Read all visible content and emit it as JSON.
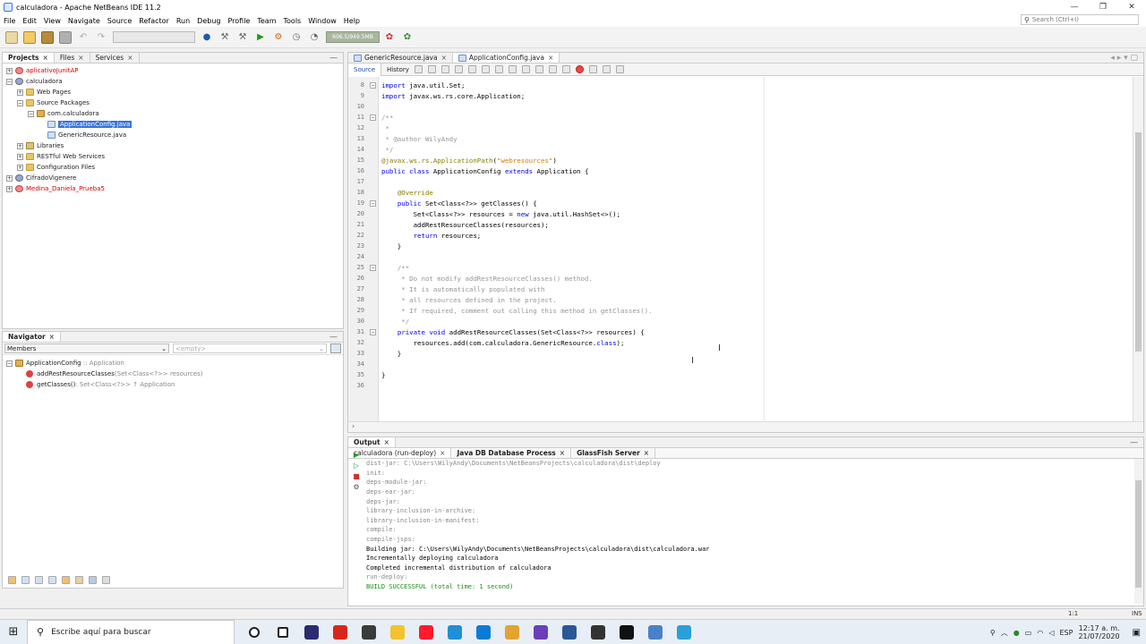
{
  "window": {
    "title": "calculadora - Apache NetBeans IDE 11.2",
    "controls": [
      "—",
      "❐",
      "✕"
    ]
  },
  "menu": [
    "File",
    "Edit",
    "View",
    "Navigate",
    "Source",
    "Refactor",
    "Run",
    "Debug",
    "Profile",
    "Team",
    "Tools",
    "Window",
    "Help"
  ],
  "search": {
    "placeholder": "Search (Ctrl+I)"
  },
  "toolbar": {
    "memory": "606.5/949.5MB"
  },
  "projects_panel": {
    "tabs": [
      "Projects",
      "Files",
      "Services"
    ],
    "tree": [
      {
        "label": "aplicativoJunitAP",
        "level": 0,
        "exp": "+",
        "icon": "proj-err",
        "cls": "red"
      },
      {
        "label": "calculadora",
        "level": 0,
        "exp": "−",
        "icon": "proj",
        "cls": ""
      },
      {
        "label": "Web Pages",
        "level": 1,
        "exp": "+",
        "icon": "folder",
        "cls": ""
      },
      {
        "label": "Source Packages",
        "level": 1,
        "exp": "−",
        "icon": "folder",
        "cls": ""
      },
      {
        "label": "com.calculadora",
        "level": 2,
        "exp": "−",
        "icon": "pkg",
        "cls": ""
      },
      {
        "label": "ApplicationConfig.java",
        "level": 3,
        "exp": "",
        "icon": "java",
        "cls": "sel"
      },
      {
        "label": "GenericResource.java",
        "level": 3,
        "exp": "",
        "icon": "java",
        "cls": ""
      },
      {
        "label": "Libraries",
        "level": 1,
        "exp": "+",
        "icon": "lib",
        "cls": ""
      },
      {
        "label": "RESTful Web Services",
        "level": 1,
        "exp": "+",
        "icon": "folder",
        "cls": ""
      },
      {
        "label": "Configuration Files",
        "level": 1,
        "exp": "+",
        "icon": "folder",
        "cls": ""
      },
      {
        "label": "CifradoVigenere",
        "level": 0,
        "exp": "+",
        "icon": "proj",
        "cls": ""
      },
      {
        "label": "Medina_Daniela_Prueba5",
        "level": 0,
        "exp": "+",
        "icon": "proj-err",
        "cls": "red"
      }
    ]
  },
  "navigator": {
    "title": "Navigator",
    "filter": "Members",
    "empty": "<empty>",
    "root_name": "ApplicationConfig",
    "root_type": ":: Application",
    "members": [
      {
        "name": "addRestResourceClasses",
        "sig": "(Set<Class<?>> resources)"
      },
      {
        "name": "getClasses()",
        "sig": ": Set<Class<?>> ↑ Application"
      }
    ]
  },
  "editor": {
    "tabs": [
      "GenericResource.java",
      "ApplicationConfig.java"
    ],
    "active_tab": 1,
    "modes": [
      "Source",
      "History"
    ],
    "lines": [
      {
        "n": "8",
        "fold": "−",
        "html": "<span class=\"kw\">import</span> java.util.Set;"
      },
      {
        "n": "9",
        "fold": "",
        "html": "<span class=\"kw\">import</span> javax.ws.rs.core.Application;"
      },
      {
        "n": "10",
        "fold": "",
        "html": ""
      },
      {
        "n": "11",
        "fold": "−",
        "html": "<span class=\"cm\">/**</span>"
      },
      {
        "n": "12",
        "fold": "",
        "html": "<span class=\"cm\"> *</span>"
      },
      {
        "n": "13",
        "fold": "",
        "html": "<span class=\"cm\"> * @author WilyAndy</span>"
      },
      {
        "n": "14",
        "fold": "",
        "html": "<span class=\"cm\"> */</span>"
      },
      {
        "n": "15",
        "fold": "",
        "html": "<span class=\"ann\">@javax.ws.rs.ApplicationPath</span>(<span class=\"str\">\"webresources\"</span>)"
      },
      {
        "n": "16",
        "fold": "",
        "html": "<span class=\"kw\">public class</span> ApplicationConfig <span class=\"kw\">extends</span> Application {"
      },
      {
        "n": "17",
        "fold": "",
        "html": ""
      },
      {
        "n": "18",
        "fold": "",
        "html": "    <span class=\"ann\">@Override</span>"
      },
      {
        "n": "19",
        "fold": "−",
        "html": "    <span class=\"kw\">public</span> Set&lt;Class&lt;?&gt;&gt; getClasses() {"
      },
      {
        "n": "20",
        "fold": "",
        "html": "        Set&lt;Class&lt;?&gt;&gt; resources = <span class=\"kw\">new</span> java.util.HashSet&lt;&gt;();"
      },
      {
        "n": "21",
        "fold": "",
        "html": "        addRestResourceClasses(resources);"
      },
      {
        "n": "22",
        "fold": "",
        "html": "        <span class=\"kw\">return</span> resources;"
      },
      {
        "n": "23",
        "fold": "",
        "html": "    }"
      },
      {
        "n": "24",
        "fold": "",
        "html": ""
      },
      {
        "n": "25",
        "fold": "−",
        "html": "    <span class=\"cm\">/**</span>"
      },
      {
        "n": "26",
        "fold": "",
        "html": "<span class=\"cm\">     * Do not modify addRestResourceClasses() method.</span>"
      },
      {
        "n": "27",
        "fold": "",
        "html": "<span class=\"cm\">     * It is automatically populated with</span>"
      },
      {
        "n": "28",
        "fold": "",
        "html": "<span class=\"cm\">     * all resources defined in the project.</span>"
      },
      {
        "n": "29",
        "fold": "",
        "html": "<span class=\"cm\">     * If required, comment out calling this method in getClasses().</span>"
      },
      {
        "n": "30",
        "fold": "",
        "html": "<span class=\"cm\">     */</span>"
      },
      {
        "n": "31",
        "fold": "−",
        "html": "    <span class=\"kw\">private void</span> addRestResourceClasses(Set&lt;Class&lt;?&gt;&gt; resources) {"
      },
      {
        "n": "32",
        "fold": "",
        "html": "        resources.add(com.calculadora.GenericResource.<span class=\"kw\">class</span>);"
      },
      {
        "n": "33",
        "fold": "",
        "html": "    }"
      },
      {
        "n": "34",
        "fold": "",
        "html": ""
      },
      {
        "n": "35",
        "fold": "",
        "html": "}"
      },
      {
        "n": "36",
        "fold": "",
        "html": ""
      }
    ]
  },
  "output": {
    "title": "Output",
    "tabs": [
      "calculadora (run-deploy)",
      "Java DB Database Process",
      "GlassFish Server"
    ],
    "lines": [
      {
        "t": "dist-jar: C:\\Users\\WilyAndy\\Documents\\NetBeansProjects\\calculadora\\dist\\deploy",
        "c": ""
      },
      {
        "t": "init:",
        "c": ""
      },
      {
        "t": "deps-module-jar:",
        "c": ""
      },
      {
        "t": "deps-ear-jar:",
        "c": ""
      },
      {
        "t": "deps-jar:",
        "c": ""
      },
      {
        "t": "library-inclusion-in-archive:",
        "c": ""
      },
      {
        "t": "library-inclusion-in-manifest:",
        "c": ""
      },
      {
        "t": "compile:",
        "c": ""
      },
      {
        "t": "compile-jsps:",
        "c": ""
      },
      {
        "t": "Building jar: C:\\Users\\WilyAndy\\Documents\\NetBeansProjects\\calculadora\\dist\\calculadora.war",
        "c": "dark"
      },
      {
        "t": "Incrementally deploying calculadora",
        "c": "dark"
      },
      {
        "t": "Completed incremental distribution of calculadora",
        "c": "dark"
      },
      {
        "t": "run-deploy:",
        "c": ""
      },
      {
        "t": "BUILD SUCCESSFUL (total time: 1 second)",
        "c": "green"
      }
    ]
  },
  "status": {
    "position": "1:1",
    "mode": "INS"
  },
  "taskbar": {
    "search_text": "Escribe aquí para buscar",
    "time": "12:17 a. m.",
    "date": "21/07/2020",
    "lang": "ESP",
    "apps": [
      {
        "name": "cortana-icon",
        "color": "#ffffff"
      },
      {
        "name": "task-view-icon",
        "color": "#ffffff"
      },
      {
        "name": "app-icon-1",
        "color": "#2b2b6f"
      },
      {
        "name": "acrobat-icon",
        "color": "#d9261c"
      },
      {
        "name": "app-icon-2",
        "color": "#3b3b3b"
      },
      {
        "name": "explorer-icon",
        "color": "#f2c230"
      },
      {
        "name": "opera-icon",
        "color": "#ff1b2d"
      },
      {
        "name": "app-icon-3",
        "color": "#1f8fd6"
      },
      {
        "name": "edge-icon",
        "color": "#0a7bd6"
      },
      {
        "name": "app-icon-4",
        "color": "#e2a330"
      },
      {
        "name": "vscode-icon",
        "color": "#6a3fb8"
      },
      {
        "name": "word-icon",
        "color": "#2b5797"
      },
      {
        "name": "github-icon",
        "color": "#333333"
      },
      {
        "name": "terminal-icon",
        "color": "#111111"
      },
      {
        "name": "app-icon-5",
        "color": "#4a80c8"
      },
      {
        "name": "netbeans-icon",
        "color": "#2aa0d8"
      }
    ]
  }
}
